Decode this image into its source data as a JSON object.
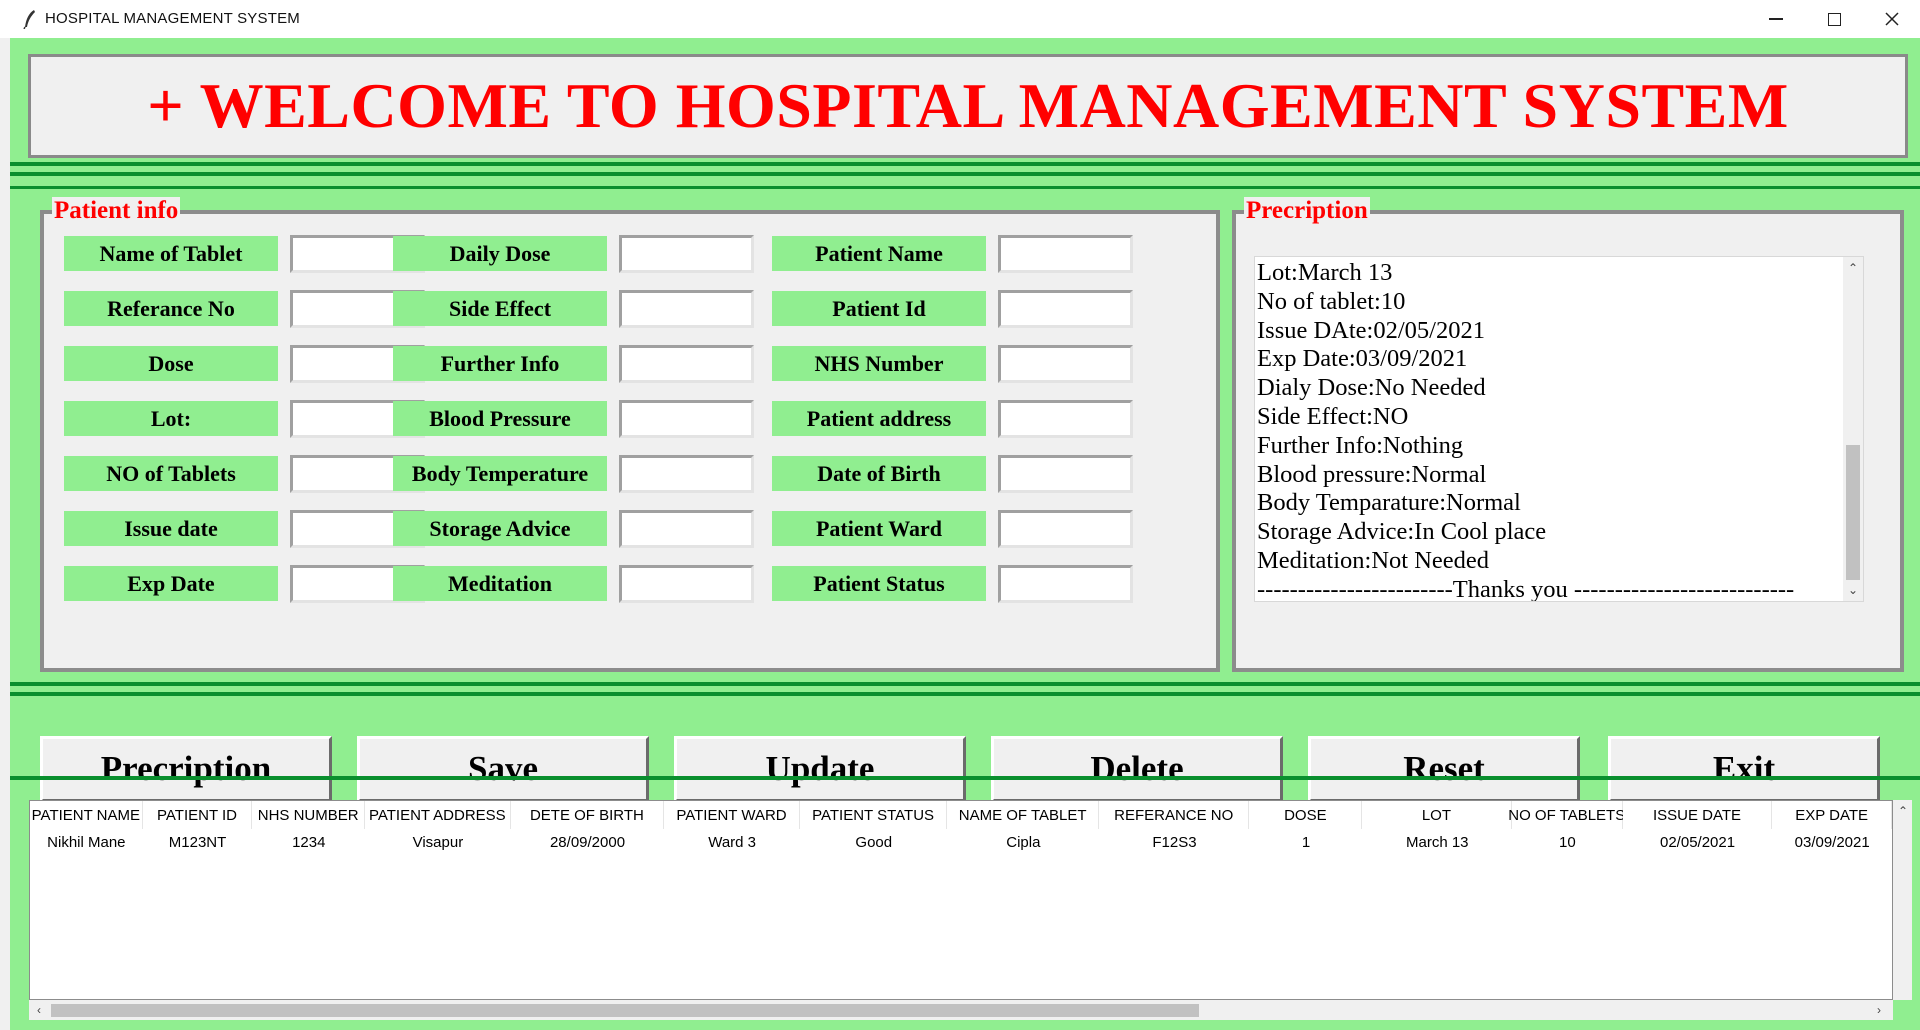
{
  "window": {
    "title": "HOSPITAL MANAGEMENT SYSTEM",
    "icons": {
      "app": "feather-icon",
      "minimize": "minimize-icon",
      "maximize": "maximize-icon",
      "close": "close-icon"
    }
  },
  "colors": {
    "panel_bg": "#90ee90",
    "accent_bar": "#0a8f2e",
    "title_red": "#ff0000",
    "label_bg": "#90ee90"
  },
  "banner": {
    "text": "+ WELCOME TO HOSPITAL MANAGEMENT SYSTEM"
  },
  "patient_info": {
    "title": "Patient info",
    "fields": [
      {
        "label": "Name of Tablet",
        "value": ""
      },
      {
        "label": "Referance No",
        "value": ""
      },
      {
        "label": "Dose",
        "value": ""
      },
      {
        "label": "Lot:",
        "value": ""
      },
      {
        "label": "NO of Tablets",
        "value": ""
      },
      {
        "label": "Issue date",
        "value": ""
      },
      {
        "label": "Exp Date",
        "value": ""
      },
      {
        "label": "Daily Dose",
        "value": ""
      },
      {
        "label": "Side Effect",
        "value": ""
      },
      {
        "label": "Further Info",
        "value": ""
      },
      {
        "label": "Blood Pressure",
        "value": ""
      },
      {
        "label": "Body Temperature",
        "value": ""
      },
      {
        "label": "Storage Advice",
        "value": ""
      },
      {
        "label": "Meditation",
        "value": ""
      },
      {
        "label": "Patient Name",
        "value": ""
      },
      {
        "label": "Patient Id",
        "value": ""
      },
      {
        "label": "NHS Number",
        "value": ""
      },
      {
        "label": "Patient address",
        "value": ""
      },
      {
        "label": "Date of Birth",
        "value": ""
      },
      {
        "label": "Patient Ward",
        "value": ""
      },
      {
        "label": "Patient Status",
        "value": ""
      }
    ]
  },
  "prescription": {
    "title": "Precription",
    "lines": [
      "Lot:March 13",
      "No of tablet:10",
      "Issue DAte:02/05/2021",
      "Exp Date:03/09/2021",
      "Dialy Dose:No Needed",
      "Side Effect:NO",
      "Further Info:Nothing",
      "Blood pressure:Normal",
      "Body Temparature:Normal",
      "Storage Advice:In Cool place",
      "Meditation:Not Needed",
      "------------------------Thanks you ---------------------------"
    ]
  },
  "buttons": [
    "Precription",
    "Save",
    "Update",
    "Delete",
    "Reset",
    "Exit"
  ],
  "table": {
    "columns": [
      "PATIENT NAME",
      "PATIENT ID",
      "NHS NUMBER",
      "PATIENT ADDRESS",
      "DETE OF BIRTH",
      "PATIENT WARD",
      "PATIENT STATUS",
      "NAME OF TABLET",
      "REFERANCE NO",
      "DOSE",
      "LOT",
      "NO OF TABLETS",
      "ISSUE DATE",
      "EXP DATE"
    ],
    "rows": [
      [
        "Nikhil Mane",
        "M123NT",
        "1234",
        "Visapur",
        "28/09/2000",
        "Ward 3",
        "Good",
        "Cipla",
        "F12S3",
        "1",
        "March 13",
        "10",
        "02/05/2021",
        "03/09/2021"
      ]
    ]
  }
}
